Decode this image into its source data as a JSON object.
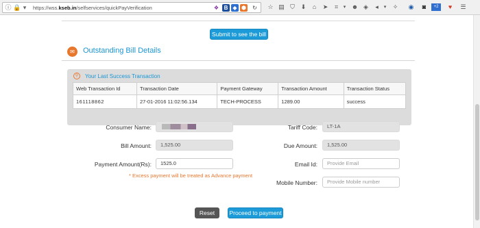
{
  "browser": {
    "url_prefix": "https://wss.",
    "url_domain": "kseb.in",
    "url_path": "/selfservices/quickPayVerification",
    "reload_icon": "reload-icon",
    "toolbar_icons": [
      "star-icon",
      "reading-list-icon",
      "pocket-icon",
      "download-icon",
      "home-icon",
      "send-icon",
      "crop-icon",
      "menu-icon"
    ]
  },
  "submit_button": "Submit to see the bill",
  "section": {
    "icon": "bill-icon",
    "title": "Outstanding Bill Details"
  },
  "transaction": {
    "title": "Your Last Success Transaction",
    "columns": [
      "Web Transaction Id",
      "Transaction Date",
      "Payment Gateway",
      "Transaction Amount",
      "Transaction Status"
    ],
    "row": [
      "161118862",
      "27-01-2016 11:02:56.134",
      "TECH-PROCESS",
      "1289.00",
      "success"
    ]
  },
  "form": {
    "consumer_name_label": "Consumer Name:",
    "consumer_name_value": "",
    "tariff_code_label": "Tariff Code:",
    "tariff_code_value": "LT-1A",
    "bill_amount_label": "Bill Amount:",
    "bill_amount_value": "1,525.00",
    "due_amount_label": "Due Amount:",
    "due_amount_value": "1,525.00",
    "payment_amount_label": "Payment Amount(Rs):",
    "payment_amount_value": "1525.0",
    "email_label": "Email Id:",
    "email_placeholder": "Provide Email",
    "mobile_label": "Mobile Number:",
    "mobile_placeholder": "Provide Mobile number",
    "note": "* Excess payment will be treated as Advance payment"
  },
  "buttons": {
    "reset": "Reset",
    "proceed": "Proceed to payment"
  },
  "colors": {
    "accent_blue": "#1c9bd8",
    "accent_orange": "#e8772e",
    "panel_gray": "#dcdcdc"
  }
}
